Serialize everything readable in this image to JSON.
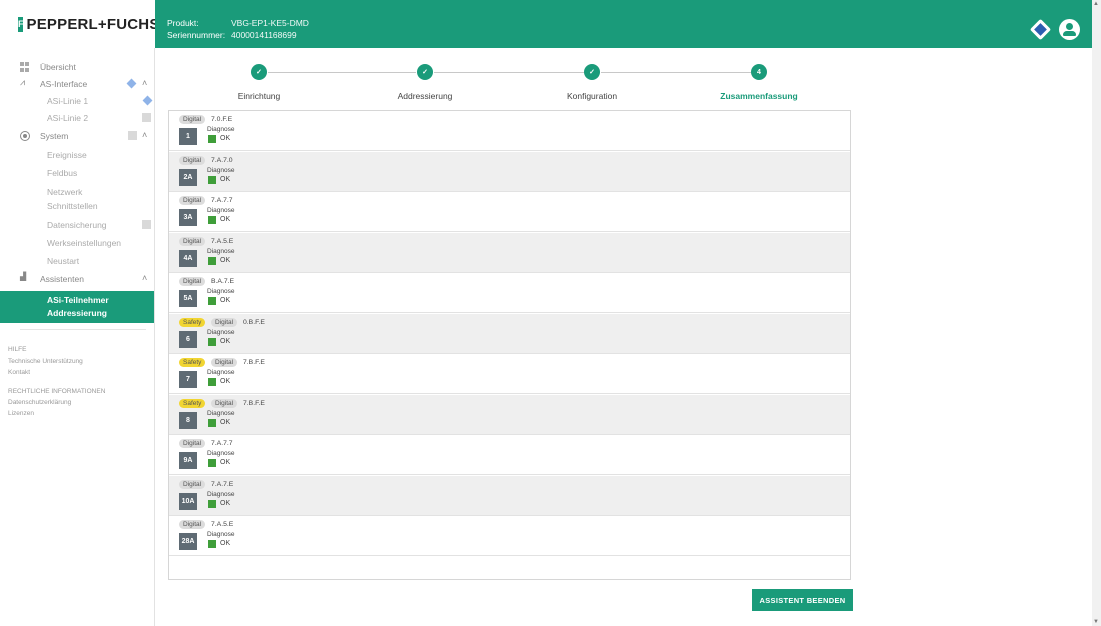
{
  "logo": {
    "mark": "F",
    "text": "PEPPERL+FUCHS"
  },
  "header": {
    "product_label": "Produkt:",
    "product_value": "VBG-EP1-KE5-DMD",
    "serial_label": "Seriennummer:",
    "serial_value": "40000141168699"
  },
  "colors": {
    "accent": "#1a9b7a",
    "safety": "#f1d532",
    "ok": "#3f9e3a"
  },
  "sidebar": {
    "overview": "Übersicht",
    "as_interface": "AS-Interface",
    "asi_line1": "ASi-Linie 1",
    "asi_line2": "ASi-Linie 2",
    "system": "System",
    "events": "Ereignisse",
    "fieldbus": "Feldbus",
    "network1": "Netzwerk",
    "network2": "Schnittstellen",
    "backup": "Datensicherung",
    "factory": "Werkseinstellungen",
    "restart": "Neustart",
    "assistants": "Assistenten",
    "active1": "ASi-Teilnehmer",
    "active2": "Addressierung",
    "help_title": "HILFE",
    "help_support": "Technische Unterstützung",
    "help_contact": "Kontakt",
    "legal_title": "RECHTLICHE INFORMATIONEN",
    "legal_privacy": "Datenschutzerklärung",
    "legal_licenses": "Lizenzen"
  },
  "steps": [
    {
      "label": "Einrichtung",
      "state": "done"
    },
    {
      "label": "Addressierung",
      "state": "done"
    },
    {
      "label": "Konfiguration",
      "state": "done"
    },
    {
      "label": "Zusammenfassung",
      "state": "active",
      "number": "4"
    }
  ],
  "rows": [
    {
      "safety": "",
      "digital": "Digital",
      "code": "7.0.F.E",
      "addr": "1",
      "diag": "Diagnose",
      "status": "OK"
    },
    {
      "safety": "",
      "digital": "Digital",
      "code": "7.A.7.0",
      "addr": "2A",
      "diag": "Diagnose",
      "status": "OK"
    },
    {
      "safety": "",
      "digital": "Digital",
      "code": "7.A.7.7",
      "addr": "3A",
      "diag": "Diagnose",
      "status": "OK"
    },
    {
      "safety": "",
      "digital": "Digital",
      "code": "7.A.5.E",
      "addr": "4A",
      "diag": "Diagnose",
      "status": "OK"
    },
    {
      "safety": "",
      "digital": "Digital",
      "code": "B.A.7.E",
      "addr": "5A",
      "diag": "Diagnose",
      "status": "OK"
    },
    {
      "safety": "Safety",
      "digital": "Digital",
      "code": "0.B.F.E",
      "addr": "6",
      "diag": "Diagnose",
      "status": "OK"
    },
    {
      "safety": "Safety",
      "digital": "Digital",
      "code": "7.B.F.E",
      "addr": "7",
      "diag": "Diagnose",
      "status": "OK"
    },
    {
      "safety": "Safety",
      "digital": "Digital",
      "code": "7.B.F.E",
      "addr": "8",
      "diag": "Diagnose",
      "status": "OK"
    },
    {
      "safety": "",
      "digital": "Digital",
      "code": "7.A.7.7",
      "addr": "9A",
      "diag": "Diagnose",
      "status": "OK"
    },
    {
      "safety": "",
      "digital": "Digital",
      "code": "7.A.7.E",
      "addr": "10A",
      "diag": "Diagnose",
      "status": "OK"
    },
    {
      "safety": "",
      "digital": "Digital",
      "code": "7.A.5.E",
      "addr": "28A",
      "diag": "Diagnose",
      "status": "OK"
    }
  ],
  "finish_button": "ASSISTENT BEENDEN",
  "icons": {
    "diamond": "diamond-icon",
    "user": "user-icon",
    "check": "check-icon"
  }
}
